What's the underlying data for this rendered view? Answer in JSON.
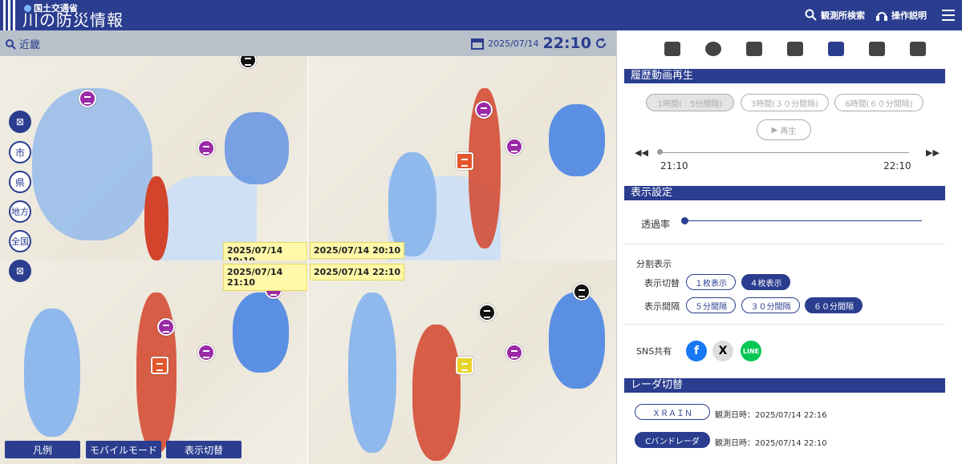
{
  "header": {
    "agency": "国土交通省",
    "title": "川の防災情報",
    "search_label": "観測所検索",
    "help_label": "操作説明"
  },
  "mapbar": {
    "region": "近畿",
    "date": "2025/07/14",
    "time": "22:10"
  },
  "maps": [
    {
      "stamp": "2025/07/14 19:10"
    },
    {
      "stamp": "2025/07/14 20:10"
    },
    {
      "stamp": "2025/07/14 21:10"
    },
    {
      "stamp": "2025/07/14 22:10"
    }
  ],
  "zoom": {
    "city": "市",
    "pref": "県",
    "area": "地方",
    "nation": "全国"
  },
  "bottom": {
    "legend": "凡例",
    "mobile": "モバイルモード",
    "toggle": "表示切替"
  },
  "panel": {
    "history": {
      "title": "履歴動画再生",
      "opt1": "1時間(　5分間隔)",
      "opt2": "3時間(３０分間隔)",
      "opt3": "6時間(６０分間隔)",
      "play": "再生",
      "start": "21:10",
      "end": "22:10"
    },
    "display": {
      "title": "表示設定",
      "opacity": "透過率",
      "split": "分割表示",
      "switch_label": "表示切替",
      "one": "１枚表示",
      "four": "４枚表示",
      "interval_label": "表示間隔",
      "i5": "５分間隔",
      "i30": "３０分間隔",
      "i60": "６０分間隔",
      "sns": "SNS共有"
    },
    "radar": {
      "title": "レーダ切替",
      "xrain": "ＸＲＡＩＮ",
      "xrain_time": "観測日時：2025/07/14 22:16",
      "cband": "Cバンドレーダ",
      "cband_time": "観測日時：2025/07/14 22:10"
    }
  }
}
